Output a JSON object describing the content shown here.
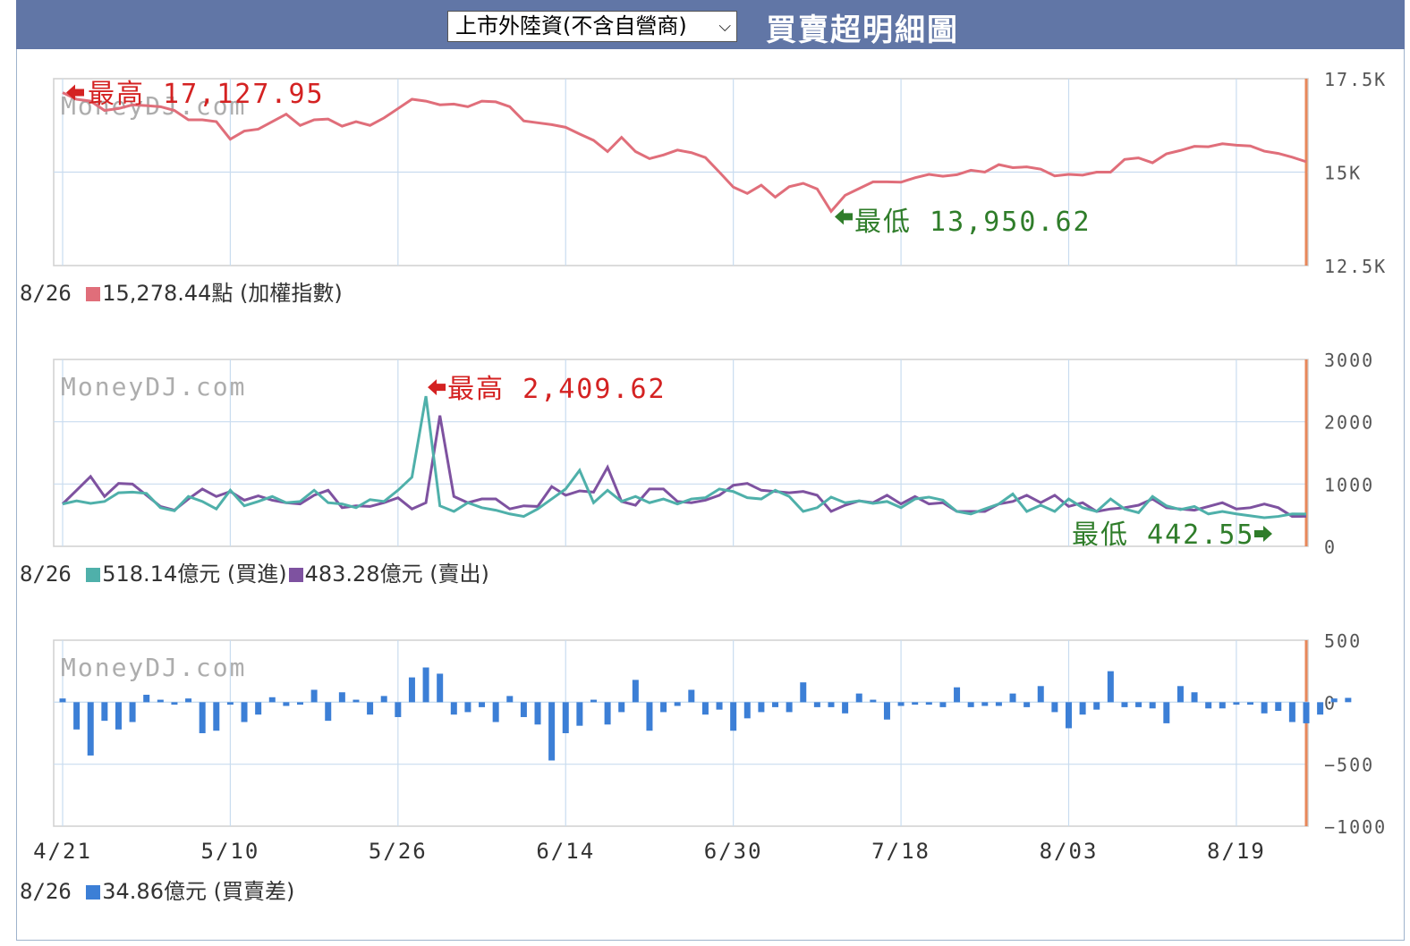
{
  "header": {
    "dropdown_selected": "上市外陸資(不含自營商)",
    "title": "買賣超明細圖"
  },
  "watermark": "MoneyDJ.com",
  "x_axis_labels": [
    "4/21",
    "5/10",
    "5/26",
    "6/14",
    "6/30",
    "7/18",
    "8/03",
    "8/19"
  ],
  "colors": {
    "index": "#e06e7a",
    "buy": "#4fb0aa",
    "sell": "#7e52a0",
    "diff": "#3c7fd6",
    "high": "#d42222",
    "low": "#2f7d2a",
    "marker": "#e8875a"
  },
  "panel1": {
    "y_ticks": [
      "17.5K",
      "15K",
      "12.5K"
    ],
    "high_label": "最高 17,127.95",
    "low_label": "最低 13,950.62",
    "legend_date": "8/26",
    "legend_value": "15,278.44點 (加權指數)"
  },
  "panel2": {
    "y_ticks": [
      "3000",
      "2000",
      "1000",
      "0"
    ],
    "high_label": "最高 2,409.62",
    "low_label": "最低 442.55",
    "legend_date": "8/26",
    "legend_buy": "518.14億元 (買進)",
    "legend_sell": "483.28億元 (賣出)"
  },
  "panel3": {
    "y_ticks": [
      "500",
      "0",
      "−500",
      "−1000"
    ],
    "legend_date": "8/26",
    "legend_value": "34.86億元 (買賣差)"
  },
  "chart_data": [
    {
      "type": "line",
      "title": "",
      "ylabel": "加權指數",
      "ylim": [
        12500,
        17500
      ],
      "x_tick_positions": [
        0,
        12,
        24,
        36,
        48,
        60,
        72,
        84
      ],
      "series": [
        {
          "name": "加權指數",
          "values": [
            17128,
            16950,
            16900,
            16650,
            16700,
            16800,
            16780,
            16750,
            16650,
            16400,
            16400,
            16350,
            15880,
            16100,
            16150,
            16350,
            16550,
            16250,
            16400,
            16420,
            16230,
            16350,
            16250,
            16450,
            16700,
            16950,
            16900,
            16800,
            16820,
            16750,
            16900,
            16880,
            16750,
            16370,
            16320,
            16270,
            16200,
            16020,
            15850,
            15550,
            15930,
            15550,
            15360,
            15460,
            15590,
            15520,
            15390,
            15000,
            14600,
            14430,
            14650,
            14330,
            14610,
            14700,
            14550,
            13950,
            14380,
            14560,
            14740,
            14740,
            14730,
            14850,
            14940,
            14890,
            14930,
            15050,
            15000,
            15200,
            15120,
            15140,
            15080,
            14900,
            14940,
            14920,
            15000,
            15000,
            15340,
            15380,
            15250,
            15490,
            15580,
            15690,
            15680,
            15760,
            15720,
            15700,
            15560,
            15500,
            15400,
            15278
          ]
        }
      ]
    },
    {
      "type": "line",
      "title": "",
      "ylabel": "億元",
      "ylim": [
        0,
        3000
      ],
      "x_tick_positions": [
        0,
        12,
        24,
        36,
        48,
        60,
        72,
        84
      ],
      "series": [
        {
          "name": "買進",
          "values": [
            680,
            730,
            690,
            720,
            860,
            870,
            850,
            620,
            570,
            800,
            720,
            600,
            900,
            650,
            720,
            800,
            700,
            720,
            900,
            700,
            680,
            620,
            750,
            720,
            900,
            1110,
            2410,
            650,
            560,
            700,
            620,
            580,
            520,
            480,
            600,
            760,
            920,
            1220,
            700,
            900,
            720,
            800,
            700,
            760,
            680,
            760,
            780,
            920,
            880,
            780,
            760,
            900,
            800,
            560,
            620,
            790,
            700,
            730,
            690,
            720,
            620,
            760,
            790,
            740,
            560,
            520,
            600,
            680,
            840,
            560,
            660,
            560,
            760,
            620,
            560,
            760,
            600,
            540,
            800,
            650,
            590,
            640,
            520,
            560,
            520,
            490,
            460,
            480,
            520,
            518
          ]
        },
        {
          "name": "賣出",
          "values": [
            680,
            900,
            1120,
            800,
            1010,
            1000,
            820,
            640,
            580,
            760,
            920,
            800,
            880,
            740,
            810,
            740,
            700,
            680,
            820,
            900,
            620,
            650,
            640,
            700,
            780,
            600,
            700,
            2100,
            800,
            700,
            760,
            760,
            600,
            650,
            640,
            960,
            820,
            890,
            870,
            1270,
            720,
            660,
            920,
            920,
            720,
            700,
            740,
            820,
            980,
            1010,
            900,
            880,
            860,
            880,
            820,
            560,
            660,
            730,
            700,
            820,
            680,
            800,
            680,
            700,
            560,
            560,
            560,
            680,
            720,
            820,
            700,
            820,
            640,
            700,
            560,
            600,
            620,
            660,
            760,
            620,
            600,
            580,
            640,
            700,
            600,
            620,
            680,
            620,
            480,
            483
          ]
        }
      ],
      "annotations": {
        "max": 2409.62,
        "min": 442.55
      }
    },
    {
      "type": "bar",
      "title": "",
      "ylabel": "億元",
      "ylim": [
        -1000,
        500
      ],
      "x_tick_positions": [
        0,
        12,
        24,
        36,
        48,
        60,
        72,
        84
      ],
      "series": [
        {
          "name": "買賣差",
          "values": [
            30,
            -220,
            -430,
            -150,
            -220,
            -160,
            60,
            20,
            -20,
            30,
            -250,
            -230,
            -20,
            -160,
            -100,
            40,
            -30,
            -20,
            100,
            -150,
            80,
            20,
            -100,
            50,
            -120,
            200,
            280,
            230,
            -100,
            -80,
            -40,
            -160,
            50,
            -120,
            -180,
            -470,
            -250,
            -190,
            20,
            -180,
            -80,
            180,
            -230,
            -80,
            -30,
            100,
            -100,
            -60,
            -230,
            -130,
            -80,
            -40,
            -80,
            160,
            -40,
            -40,
            -90,
            70,
            20,
            -140,
            -30,
            -20,
            -20,
            -40,
            120,
            -40,
            -30,
            -30,
            70,
            -40,
            130,
            -80,
            -210,
            -100,
            -60,
            250,
            -40,
            -40,
            -50,
            -170,
            130,
            80,
            -50,
            -50,
            -20,
            -20,
            -90,
            -70,
            -160,
            -170,
            -100,
            30,
            35
          ]
        }
      ]
    }
  ]
}
